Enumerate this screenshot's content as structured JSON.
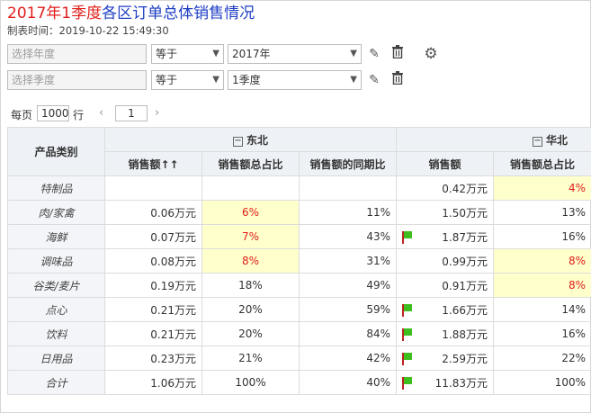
{
  "title": {
    "highlight": "2017年1季度",
    "rest": "各区订单总体销售情况"
  },
  "subtitle": "制表时间：2019-10-22 15:49:30",
  "filters": [
    {
      "field_placeholder": "选择年度",
      "operator": "等于",
      "value": "2017年"
    },
    {
      "field_placeholder": "选择季度",
      "operator": "等于",
      "value": "1季度"
    }
  ],
  "icons": {
    "edit": "pencil-icon",
    "delete": "trash-icon",
    "settings": "gear-icon"
  },
  "pager": {
    "per_page_label": "每页",
    "per_page_value": "1000",
    "rows_label": "行",
    "page": "1"
  },
  "table": {
    "row_header": "产品类别",
    "groups": [
      {
        "name": "东北"
      },
      {
        "name": "华北"
      }
    ],
    "columns": [
      "销售额↑↑",
      "销售额总占比",
      "销售额的同期比",
      "销售额",
      "销售额总占比"
    ],
    "rows": [
      {
        "category": "特制品",
        "c1": "",
        "c2": "",
        "c3": "",
        "c4": "0.42万元",
        "c5": "4%",
        "flag": false
      },
      {
        "category": "肉/家禽",
        "c1": "0.06万元",
        "c2": "6%",
        "c3": "11%",
        "c4": "1.50万元",
        "c5": "13%",
        "flag": false
      },
      {
        "category": "海鲜",
        "c1": "0.07万元",
        "c2": "7%",
        "c3": "43%",
        "c4": "1.87万元",
        "c5": "16%",
        "flag": true
      },
      {
        "category": "调味品",
        "c1": "0.08万元",
        "c2": "8%",
        "c3": "31%",
        "c4": "0.99万元",
        "c5": "8%",
        "flag": false
      },
      {
        "category": "谷类/麦片",
        "c1": "0.19万元",
        "c2": "18%",
        "c3": "49%",
        "c4": "0.91万元",
        "c5": "8%",
        "flag": false
      },
      {
        "category": "点心",
        "c1": "0.21万元",
        "c2": "20%",
        "c3": "59%",
        "c4": "1.66万元",
        "c5": "14%",
        "flag": true
      },
      {
        "category": "饮料",
        "c1": "0.21万元",
        "c2": "20%",
        "c3": "84%",
        "c4": "1.88万元",
        "c5": "16%",
        "flag": true
      },
      {
        "category": "日用品",
        "c1": "0.23万元",
        "c2": "21%",
        "c3": "42%",
        "c4": "2.59万元",
        "c5": "22%",
        "flag": true
      },
      {
        "category": "合计",
        "c1": "1.06万元",
        "c2": "100%",
        "c3": "40%",
        "c4": "11.83万元",
        "c5": "100%",
        "flag": true
      }
    ]
  },
  "colors": {
    "highlight_bg": "#ffffcc",
    "red_text": "#e0201d",
    "title_blue": "#1f3fc4",
    "flag_green": "#3fbf1f"
  }
}
